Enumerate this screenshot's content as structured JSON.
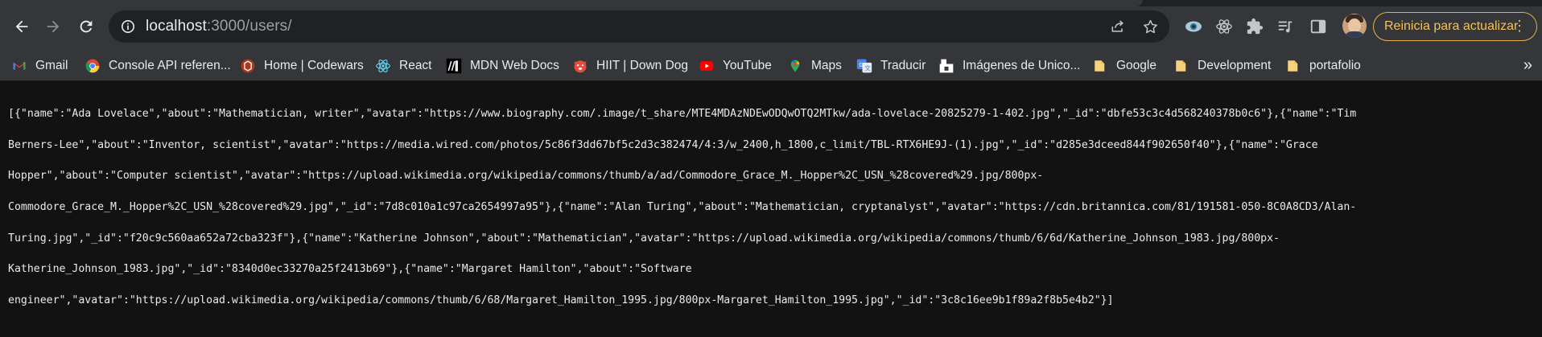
{
  "browser": {
    "url_host": "localhost",
    "url_path": ":3000/users/",
    "update_button_label": "Reinicia para actualizar",
    "update_button_menu": "⋮",
    "bookmarks_more": "»"
  },
  "bookmarks": [
    {
      "label": "Gmail",
      "icon": "gmail-icon"
    },
    {
      "label": "Console API referen...",
      "icon": "chrome-icon"
    },
    {
      "label": "Home | Codewars",
      "icon": "codewars-icon"
    },
    {
      "label": "React",
      "icon": "react-icon"
    },
    {
      "label": "MDN Web Docs",
      "icon": "mdn-icon"
    },
    {
      "label": "HIIT | Down Dog",
      "icon": "downdog-icon"
    },
    {
      "label": "YouTube",
      "icon": "youtube-icon"
    },
    {
      "label": "Maps",
      "icon": "maps-icon"
    },
    {
      "label": "Traducir",
      "icon": "translate-icon"
    },
    {
      "label": "Imágenes de Unico...",
      "icon": "unicorn-icon"
    },
    {
      "label": "Google",
      "icon": "folder-icon"
    },
    {
      "label": "Development",
      "icon": "folder-icon"
    },
    {
      "label": "portafolio",
      "icon": "folder-icon"
    }
  ],
  "json_body": {
    "lines": [
      "[{\"name\":\"Ada Lovelace\",\"about\":\"Mathematician, writer\",\"avatar\":\"https://www.biography.com/.image/t_share/MTE4MDAzNDEwODQwOTQ2MTkw/ada-lovelace-20825279-1-402.jpg\",\"_id\":\"dbfe53c3c4d568240378b0c6\"},{\"name\":\"Tim",
      "Berners-Lee\",\"about\":\"Inventor, scientist\",\"avatar\":\"https://media.wired.com/photos/5c86f3dd67bf5c2d3c382474/4:3/w_2400,h_1800,c_limit/TBL-RTX6HE9J-(1).jpg\",\"_id\":\"d285e3dceed844f902650f40\"},{\"name\":\"Grace",
      "Hopper\",\"about\":\"Computer scientist\",\"avatar\":\"https://upload.wikimedia.org/wikipedia/commons/thumb/a/ad/Commodore_Grace_M._Hopper%2C_USN_%28covered%29.jpg/800px-",
      "Commodore_Grace_M._Hopper%2C_USN_%28covered%29.jpg\",\"_id\":\"7d8c010a1c97ca2654997a95\"},{\"name\":\"Alan Turing\",\"about\":\"Mathematician, cryptanalyst\",\"avatar\":\"https://cdn.britannica.com/81/191581-050-8C0A8CD3/Alan-",
      "Turing.jpg\",\"_id\":\"f20c9c560aa652a72cba323f\"},{\"name\":\"Katherine Johnson\",\"about\":\"Mathematician\",\"avatar\":\"https://upload.wikimedia.org/wikipedia/commons/thumb/6/6d/Katherine_Johnson_1983.jpg/800px-",
      "Katherine_Johnson_1983.jpg\",\"_id\":\"8340d0ec33270a25f2413b69\"},{\"name\":\"Margaret Hamilton\",\"about\":\"Software",
      "engineer\",\"avatar\":\"https://upload.wikimedia.org/wikipedia/commons/thumb/6/68/Margaret_Hamilton_1995.jpg/800px-Margaret_Hamilton_1995.jpg\",\"_id\":\"3c8c16ee9b1f89a2f8b5e4b2\"}]"
    ]
  },
  "colors": {
    "toolbar_bg": "#35363a",
    "page_bg": "#121212",
    "update_accent": "#f2c15d"
  }
}
